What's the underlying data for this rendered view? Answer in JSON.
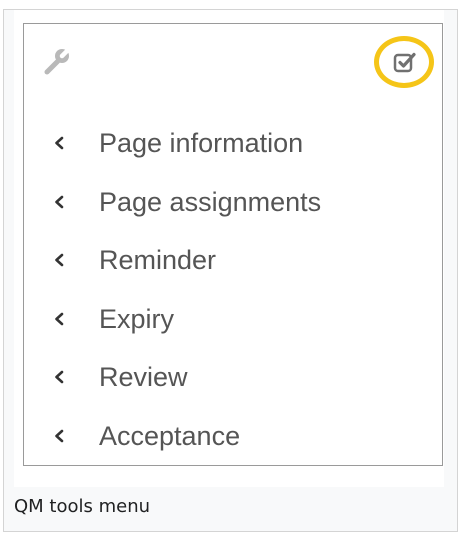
{
  "panel": {
    "icons": {
      "tools": "wrench-icon",
      "toggle": "checkbox-checked-icon",
      "expand": "chevron-left-icon"
    },
    "highlight_color": "#f5c518",
    "menu_items": [
      {
        "label": "Page information"
      },
      {
        "label": "Page assignments"
      },
      {
        "label": "Reminder"
      },
      {
        "label": "Expiry"
      },
      {
        "label": "Review"
      },
      {
        "label": "Acceptance"
      }
    ]
  },
  "caption": {
    "text": "QM tools menu"
  }
}
